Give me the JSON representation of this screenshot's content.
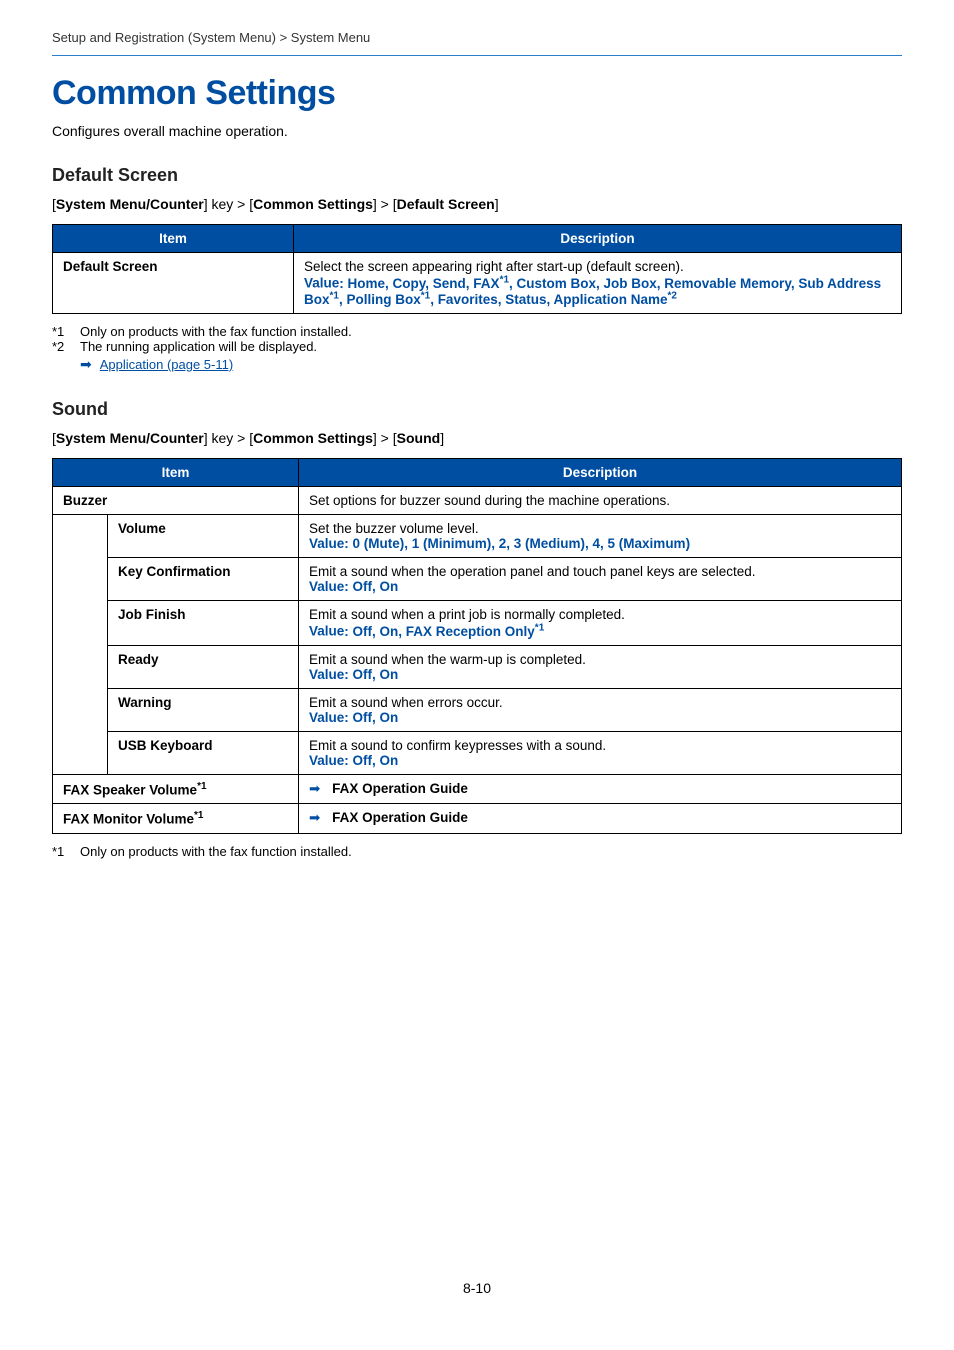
{
  "breadcrumb": "Setup and Registration (System Menu) > System Menu",
  "title": "Common Settings",
  "intro": "Configures overall machine operation.",
  "pageNumber": "8-10",
  "section1": {
    "heading": "Default Screen",
    "path_pre": "[",
    "path_a": "System Menu/Counter",
    "path_mid1": "] key > [",
    "path_b": "Common Settings",
    "path_mid2": "] > [",
    "path_c": "Default Screen",
    "path_post": "]",
    "table": {
      "head_item": "Item",
      "head_desc": "Description",
      "row_item": "Default Screen",
      "row_desc": "Select the screen appearing right after start-up (default screen).",
      "value_label": "Value",
      "value_text_1": ": Home, Copy, Send, FAX",
      "sup1": "*1",
      "value_text_2": ", Custom Box, Job Box, Removable Memory, Sub Address Box",
      "sup2": "*1",
      "value_text_3": ", Polling Box",
      "sup3": "*1",
      "value_text_4": ", Favorites, Status, Application Name",
      "sup4": "*2"
    },
    "footnotes": {
      "f1_num": "*1",
      "f1_text": "Only on products with the fax function installed.",
      "f2_num": "*2",
      "f2_text": "The running application will be displayed.",
      "link": "Application (page 5-11)"
    }
  },
  "section2": {
    "heading": "Sound",
    "path_a": "System Menu/Counter",
    "path_b": "Common Settings",
    "path_c": "Sound",
    "table": {
      "head_item": "Item",
      "head_desc": "Description",
      "buzzer_item": "Buzzer",
      "buzzer_desc": "Set options for buzzer sound during the machine operations.",
      "rows": [
        {
          "item": "Volume",
          "desc": "Set the buzzer volume level.",
          "value": ": 0 (Mute), 1 (Minimum), 2, 3 (Medium), 4, 5 (Maximum)"
        },
        {
          "item": "Key Confirmation",
          "desc": "Emit a sound when the operation panel and touch panel keys are selected.",
          "value": ": Off, On"
        },
        {
          "item": "Job Finish",
          "desc": "Emit a sound when a print job is normally completed.",
          "value": ": Off, On, FAX Reception Only",
          "sup": "*1"
        },
        {
          "item": "Ready",
          "desc": "Emit a sound when the warm-up is completed.",
          "value": ": Off, On"
        },
        {
          "item": "Warning",
          "desc": "Emit a sound when errors occur.",
          "value": ": Off, On"
        },
        {
          "item": "USB Keyboard",
          "desc": "Emit a sound to confirm keypresses with a sound.",
          "value": ": Off, On"
        }
      ],
      "fax_speaker_item": "FAX Speaker Volume",
      "fax_speaker_sup": "*1",
      "fax_speaker_ref": "FAX Operation Guide",
      "fax_monitor_item": "FAX Monitor Volume",
      "fax_monitor_sup": "*1",
      "fax_monitor_ref": "FAX Operation Guide",
      "value_label": "Value"
    },
    "footnotes": {
      "f1_num": "*1",
      "f1_text": "Only on products with the fax function installed."
    }
  }
}
